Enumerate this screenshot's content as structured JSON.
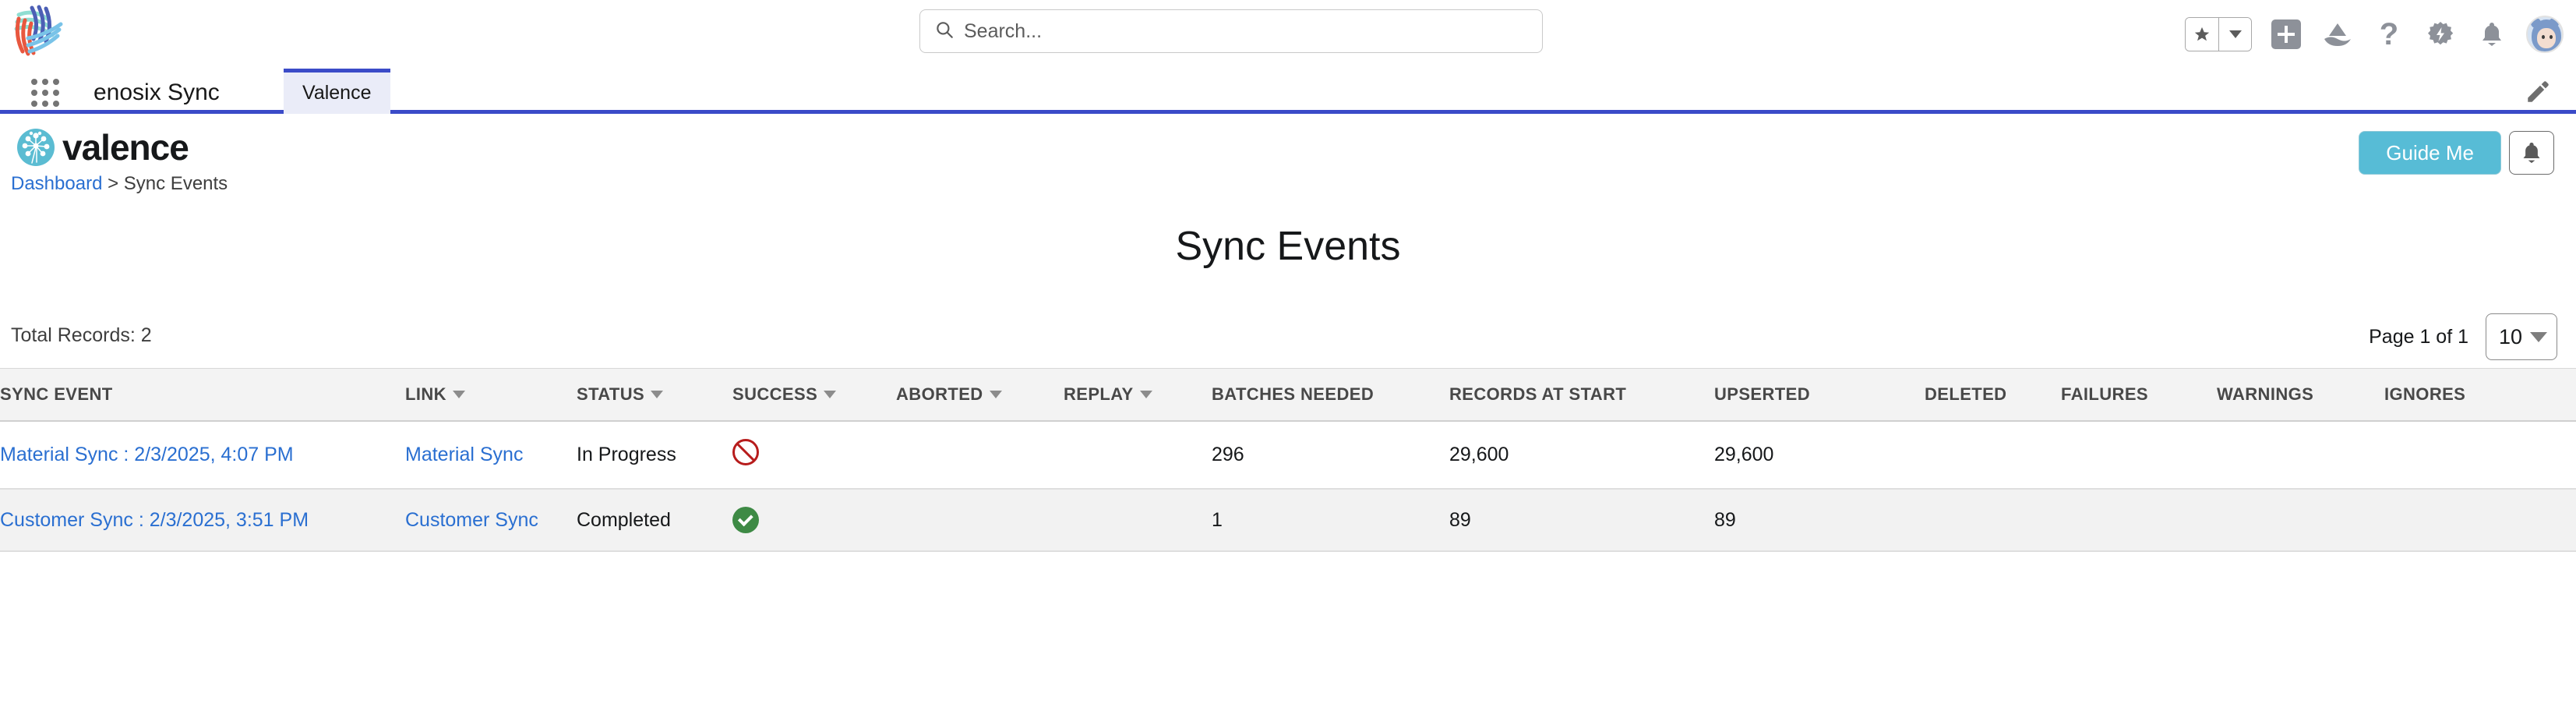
{
  "global_header": {
    "logo_name": "enosix-logo",
    "search": {
      "placeholder": "Search...",
      "value": "",
      "icon": "search-icon"
    },
    "icons": [
      {
        "name": "favorites-star-icon",
        "label": "Favorites"
      },
      {
        "name": "favorites-dropdown-icon",
        "label": "Favorites list"
      },
      {
        "name": "global-actions-plus-icon",
        "label": "Global Actions"
      },
      {
        "name": "app-launcher-mountain-icon",
        "label": "Learning"
      },
      {
        "name": "help-question-icon",
        "label": "Help"
      },
      {
        "name": "setup-gear-icon",
        "label": "Setup"
      },
      {
        "name": "notifications-bell-icon",
        "label": "Notifications"
      },
      {
        "name": "user-avatar",
        "label": "User profile"
      }
    ]
  },
  "app_bar": {
    "waffle_icon": "app-launcher-waffle-icon",
    "app_name": "enosix Sync",
    "tabs": [
      {
        "label": "Valence",
        "active": true
      }
    ],
    "edit_icon": "pencil-edit-icon",
    "accent_color": "#3b4bc8",
    "active_tab_bg": "#eaecf8"
  },
  "brand_bar": {
    "logo_mark": "valence-dandelion-icon",
    "wordmark": "valence",
    "brand_color": "#5bbcd2",
    "breadcrumb": {
      "parent": "Dashboard",
      "separator": ">",
      "current": "Sync Events"
    },
    "guide_me_label": "Guide Me",
    "bell_icon": "notifications-bell-icon"
  },
  "main": {
    "title": "Sync Events",
    "total_records_label": "Total Records: 2",
    "pagination": {
      "page_label": "Page 1 of 1",
      "page_size": "10"
    },
    "table": {
      "columns": [
        {
          "label": "SYNC EVENT",
          "sortable": false
        },
        {
          "label": "LINK",
          "sortable": true
        },
        {
          "label": "STATUS",
          "sortable": true
        },
        {
          "label": "SUCCESS",
          "sortable": true
        },
        {
          "label": "ABORTED",
          "sortable": true
        },
        {
          "label": "REPLAY",
          "sortable": true
        },
        {
          "label": "BATCHES NEEDED",
          "sortable": false
        },
        {
          "label": "RECORDS AT START",
          "sortable": false
        },
        {
          "label": "UPSERTED",
          "sortable": false
        },
        {
          "label": "DELETED",
          "sortable": false
        },
        {
          "label": "FAILURES",
          "sortable": false
        },
        {
          "label": "WARNINGS",
          "sortable": false
        },
        {
          "label": "IGNORES",
          "sortable": false
        }
      ],
      "rows": [
        {
          "sync_event": "Material Sync : 2/3/2025, 4:07 PM",
          "link": "Material Sync",
          "status": "In Progress",
          "success_icon": "ban-icon",
          "success_color": "#b71c1c",
          "aborted": "",
          "replay": "",
          "batches_needed": "296",
          "records_at_start": "29,600",
          "upserted": "29,600",
          "deleted": "",
          "failures": "",
          "warnings": "",
          "ignores": ""
        },
        {
          "sync_event": "Customer Sync : 2/3/2025, 3:51 PM",
          "link": "Customer Sync",
          "status": "Completed",
          "success_icon": "check-circle-icon",
          "success_color": "#3e8a45",
          "aborted": "",
          "replay": "",
          "batches_needed": "1",
          "records_at_start": "89",
          "upserted": "89",
          "deleted": "",
          "failures": "",
          "warnings": "",
          "ignores": ""
        }
      ]
    }
  }
}
